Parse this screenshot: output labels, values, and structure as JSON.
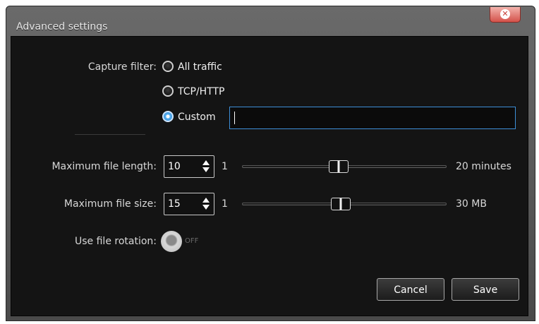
{
  "window": {
    "title": "Advanced settings"
  },
  "capture_filter": {
    "label": "Capture filter:",
    "options": [
      {
        "label": "All traffic",
        "selected": false
      },
      {
        "label": "TCP/HTTP",
        "selected": false
      },
      {
        "label": "Custom",
        "selected": true
      }
    ],
    "custom_value": ""
  },
  "max_file_length": {
    "label": "Maximum file length:",
    "value": "10",
    "slider_min": "1",
    "slider_max": "20 minutes",
    "level_fraction": 0.47
  },
  "max_file_size": {
    "label": "Maximum file size:",
    "value": "15",
    "slider_min": "1",
    "slider_max": "30 MB",
    "level_fraction": 0.48
  },
  "file_rotation": {
    "label": "Use file rotation:",
    "state": "OFF"
  },
  "buttons": {
    "cancel": "Cancel",
    "save": "Save"
  },
  "colors": {
    "accent": "#3d8fd8",
    "close_button": "#d4524a"
  },
  "icons": {
    "close": "close-icon",
    "stepper_up": "triangle-up-icon",
    "stepper_down": "triangle-down-icon"
  }
}
